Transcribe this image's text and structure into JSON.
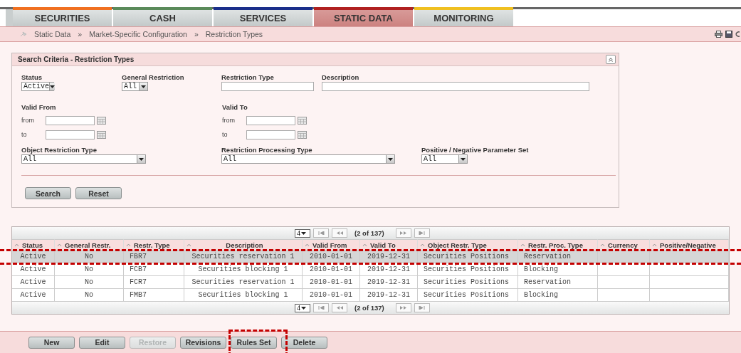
{
  "tabs": [
    {
      "label": "SECURITIES",
      "color": "#f07020",
      "selected": false
    },
    {
      "label": "CASH",
      "color": "#5a8a5a",
      "selected": false
    },
    {
      "label": "SERVICES",
      "color": "#1a2f8a",
      "selected": false
    },
    {
      "label": "STATIC DATA",
      "color": "#b02020",
      "selected": true
    },
    {
      "label": "MONITORING",
      "color": "#f0c020",
      "selected": false
    }
  ],
  "breadcrumb": {
    "separator": "»",
    "items": [
      "Static Data",
      "Market-Specific Configuration",
      "Restriction Types"
    ]
  },
  "search_panel": {
    "title": "Search Criteria - Restriction Types",
    "row_1": [
      {
        "kind": "select",
        "label": "Status",
        "value": "Active"
      },
      {
        "kind": "select",
        "label": "General Restriction",
        "value": "All"
      },
      {
        "kind": "text",
        "label": "Restriction Type"
      },
      {
        "kind": "text",
        "label": "Description"
      }
    ],
    "row_2": [
      {
        "label": "Valid From",
        "from": "from",
        "to": "to"
      },
      {
        "label": "Valid To",
        "from": "from",
        "to": "to"
      }
    ],
    "row_3": [
      {
        "label": "Object Restriction Type",
        "value": "All"
      },
      {
        "label": "Restriction Processing Type",
        "value": "All"
      },
      {
        "label": "Positive / Negative Parameter Set",
        "value": "All"
      }
    ],
    "buttons": [
      "Search",
      "Reset"
    ]
  },
  "pager_top": {
    "page_size": "4",
    "info": "(2 of 137)"
  },
  "table": {
    "columns": [
      "Status",
      "General Restr.",
      "Restr. Type",
      "Description",
      "Valid From",
      "Valid To",
      "Object Restr. Type",
      "Restr. Proc. Type",
      "Currency",
      "Positive/Negative"
    ],
    "rows": [
      {
        "selected": true,
        "cells": [
          "Active",
          "No",
          "FBR7",
          "Securities reservation 1",
          "2010-01-01",
          "2019-12-31",
          "Securities Positions",
          "Reservation",
          "",
          ""
        ]
      },
      {
        "selected": false,
        "cells": [
          "Active",
          "No",
          "FCB7",
          "Securities blocking 1",
          "2010-01-01",
          "2019-12-31",
          "Securities Positions",
          "Blocking",
          "",
          ""
        ]
      },
      {
        "selected": false,
        "cells": [
          "Active",
          "No",
          "FCR7",
          "Securities reservation 1",
          "2010-01-01",
          "2019-12-31",
          "Securities Positions",
          "Reservation",
          "",
          ""
        ]
      },
      {
        "selected": false,
        "cells": [
          "Active",
          "No",
          "FMB7",
          "Securities blocking 1",
          "2010-01-01",
          "2019-12-31",
          "Securities Positions",
          "Blocking",
          "",
          ""
        ]
      }
    ]
  },
  "pager_bottom": {
    "page_size": "4",
    "info": "(2 of 137)"
  },
  "actions": [
    {
      "label": "New",
      "disabled": false
    },
    {
      "label": "Edit",
      "disabled": false
    },
    {
      "label": "Restore",
      "disabled": true
    },
    {
      "label": "Revisions",
      "disabled": false
    },
    {
      "label": "Rules Set",
      "disabled": false
    },
    {
      "label": "Delete",
      "disabled": false
    }
  ]
}
